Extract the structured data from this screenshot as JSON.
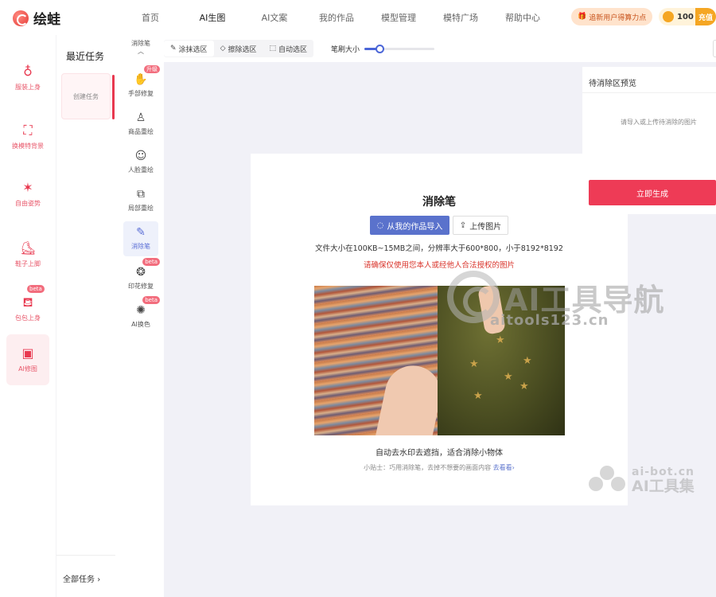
{
  "app": {
    "name": "绘蛙"
  },
  "nav": [
    {
      "label": "首页",
      "active": false
    },
    {
      "label": "AI生图",
      "active": true
    },
    {
      "label": "AI文案",
      "active": false
    },
    {
      "label": "我的作品",
      "active": false
    },
    {
      "label": "模型管理",
      "active": false
    },
    {
      "label": "模特广场",
      "active": false
    },
    {
      "label": "帮助中心",
      "active": false
    }
  ],
  "promo": {
    "label": "追新用户得算力点"
  },
  "account": {
    "coins": "100",
    "recharge": "充值"
  },
  "sidebar": [
    {
      "label": "服装上身",
      "icon": "dress-icon"
    },
    {
      "label": "换模特背景",
      "icon": "portrait-icon"
    },
    {
      "label": "自由姿势",
      "icon": "pose-icon"
    },
    {
      "label": "鞋子上脚",
      "icon": "shoe-icon"
    },
    {
      "label": "包包上身",
      "icon": "bag-icon",
      "badge": "beta"
    },
    {
      "label": "AI修图",
      "icon": "image-edit-icon",
      "active": true
    }
  ],
  "tasks": {
    "title": "最近任务",
    "create": "创建任务",
    "all": "全部任务"
  },
  "tools": {
    "header": "消除笔",
    "items": [
      {
        "label": "手部修复",
        "icon": "hand-icon",
        "badge": "升级"
      },
      {
        "label": "商品重绘",
        "icon": "shirt-icon"
      },
      {
        "label": "人脸重绘",
        "icon": "face-icon"
      },
      {
        "label": "局部重绘",
        "icon": "partial-icon"
      },
      {
        "label": "消除笔",
        "icon": "eraser-pen-icon",
        "active": true
      },
      {
        "label": "印花修复",
        "icon": "print-icon",
        "badge": "beta"
      },
      {
        "label": "AI换色",
        "icon": "palette-icon",
        "badge": "beta"
      }
    ]
  },
  "toolbar": {
    "paint": "涂抹选区",
    "erase": "擦除选区",
    "auto": "自动选区",
    "brush_label": "笔刷大小",
    "brush_value": 0.22
  },
  "card": {
    "title": "消除笔",
    "import_button": "从我的作品导入",
    "upload_button": "上传图片",
    "spec": "文件大小在100KB~15MB之间，分辨率大于600*800，小于8192*8192",
    "warning": "请确保仅使用您本人或经他人合法授权的图片",
    "caption": "自动去水印去遮挡，适合消除小物体",
    "tip": "小贴士：巧用消除笔，去掉不想要的画面内容",
    "tip_link": "去看看"
  },
  "right_panel": {
    "title": "待消除区预览",
    "hint": "请导入或上传待消除的图片",
    "generate": "立即生成"
  },
  "watermarks": {
    "main_text": "AI工具导航",
    "main_url": "aitools123.cn",
    "second_url": "ai-bot.cn",
    "second_name": "AI工具集"
  }
}
